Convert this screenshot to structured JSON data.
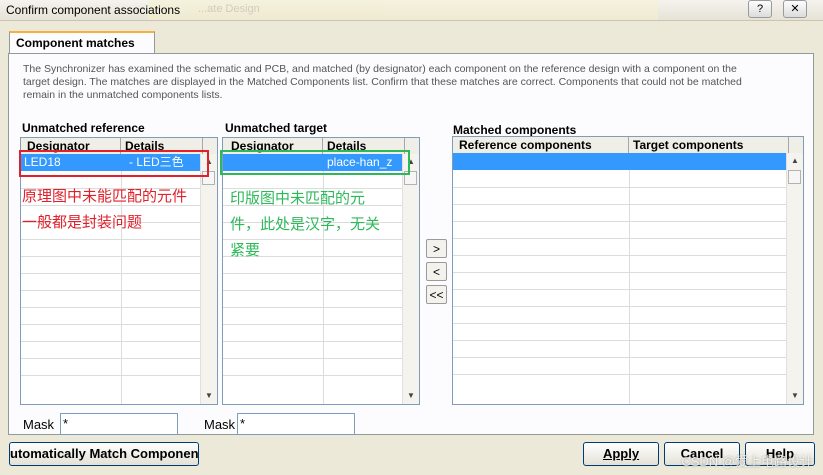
{
  "window": {
    "title": "Confirm component associations",
    "bg_text": "...ate Design",
    "help_btn": "?",
    "close_btn": "✕"
  },
  "tab": {
    "label": "Component matches"
  },
  "description": "The Synchronizer has examined the schematic and PCB, and matched (by designator) each component on the reference design with a component on the target design. The matches are displayed in the Matched Components list. Confirm that these matches are correct. Components that could not be matched remain in the unmatched components lists.",
  "unmatched_reference": {
    "title": "Unmatched reference",
    "columns": [
      "Designator",
      "Details"
    ],
    "rows": [
      {
        "designator": "LED18",
        "details": "- LED三色"
      }
    ],
    "mask_label": "Mask",
    "mask_value": "*"
  },
  "unmatched_target": {
    "title": "Unmatched  target",
    "columns": [
      "Designator",
      "Details"
    ],
    "rows": [
      {
        "designator": "",
        "details": "place-han_z"
      }
    ],
    "mask_label": "Mask",
    "mask_value": "*"
  },
  "matched": {
    "title": "Matched components",
    "columns": [
      "Reference components",
      "Target components"
    ]
  },
  "move_buttons": {
    "add": ">",
    "remove": "<",
    "remove_all": "<<"
  },
  "annotations": {
    "red_note_line1": "原理图中未能匹配的元件",
    "red_note_line2": "一般都是封装问题",
    "green_note_line1": "印版图中未匹配的元",
    "green_note_line2": "件，此处是汉字，无关",
    "green_note_line3": "紧要",
    "red_color": "#e0202a",
    "green_color": "#2db85a"
  },
  "buttons": {
    "auto_match": "utomatically Match Componen",
    "apply": "Apply",
    "cancel": "Cancel",
    "help": "Help"
  },
  "watermark": "CSDN @爱上电路设计"
}
